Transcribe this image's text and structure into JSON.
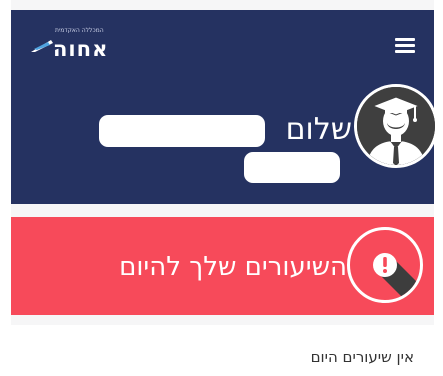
{
  "brand": {
    "name": "אחוה",
    "tagline": "המכללה האקדמית"
  },
  "header": {
    "greeting": "שלום",
    "colors": {
      "background": "#253261",
      "text": "#ffffff"
    }
  },
  "lessons_banner": {
    "title": "השיעורים שלך להיום",
    "color": "#f74a5a",
    "icon": "alert-icon"
  },
  "lessons": {
    "empty_message": "אין שיעורים היום"
  },
  "icons": {
    "menu": "hamburger-menu-icon",
    "avatar": "graduate-avatar-icon"
  }
}
